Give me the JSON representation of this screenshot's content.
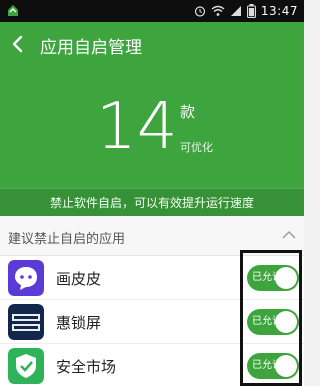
{
  "status_bar": {
    "time": "13:47",
    "icons": [
      "app-notification-icon",
      "alarm-icon",
      "wifi-icon",
      "signal-icon",
      "battery-icon"
    ]
  },
  "header": {
    "title": "应用自启管理",
    "count": "14",
    "count_unit": "款",
    "count_caption": "可优化",
    "hint": "禁止软件自启，可以有效提升运行速度",
    "background_color": "#3ea43e"
  },
  "section": {
    "title": "建议禁止自启的应用"
  },
  "apps": [
    {
      "name": "画皮皮",
      "toggle_label": "已允许",
      "icon": "huapipi-icon",
      "enabled": true
    },
    {
      "name": "惠锁屏",
      "toggle_label": "已允许",
      "icon": "money-locker-icon",
      "enabled": true
    },
    {
      "name": "安全市场",
      "toggle_label": "已允许",
      "icon": "safe-market-icon",
      "enabled": true
    }
  ]
}
